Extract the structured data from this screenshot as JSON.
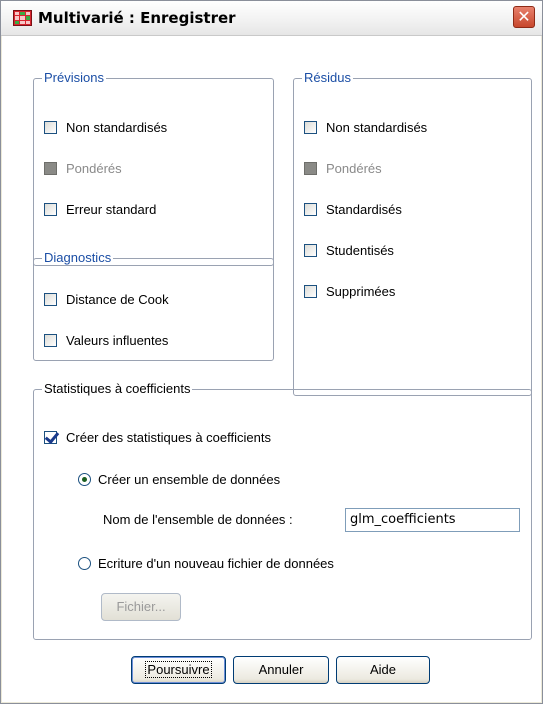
{
  "window": {
    "title": "Multivarié : Enregistrer",
    "close_glyph": "✕"
  },
  "previsions": {
    "legend": "Prévisions",
    "items": [
      {
        "label": "Non standardisés",
        "checked": false,
        "disabled": false
      },
      {
        "label": "Pondérés",
        "checked": false,
        "disabled": true
      },
      {
        "label": "Erreur standard",
        "checked": false,
        "disabled": false
      }
    ]
  },
  "residus": {
    "legend": "Résidus",
    "items": [
      {
        "label": "Non standardisés",
        "checked": false,
        "disabled": false
      },
      {
        "label": "Pondérés",
        "checked": false,
        "disabled": true
      },
      {
        "label": "Standardisés",
        "checked": false,
        "disabled": false
      },
      {
        "label": "Studentisés",
        "checked": false,
        "disabled": false
      },
      {
        "label": "Supprimées",
        "checked": false,
        "disabled": false
      }
    ]
  },
  "diagnostics": {
    "legend": "Diagnostics",
    "items": [
      {
        "label": "Distance de Cook",
        "checked": false,
        "disabled": false
      },
      {
        "label": "Valeurs influentes",
        "checked": false,
        "disabled": false
      }
    ]
  },
  "coefficients": {
    "legend": "Statistiques à coefficients",
    "create_label": "Créer des statistiques à coefficients",
    "create_checked": true,
    "radio_dataset": "Créer un ensemble de données",
    "radio_dataset_selected": true,
    "dataset_name_label": "Nom de l'ensemble de données :",
    "dataset_name_value": "glm_coefficients",
    "radio_file": "Ecriture d'un nouveau fichier de données",
    "file_button": "Fichier..."
  },
  "buttons": {
    "continue": "Poursuivre",
    "cancel": "Annuler",
    "help": "Aide"
  },
  "colors": {
    "legend_blue": "#1b4ea5",
    "close_red": "#c7472c",
    "button_border": "#003c74"
  }
}
